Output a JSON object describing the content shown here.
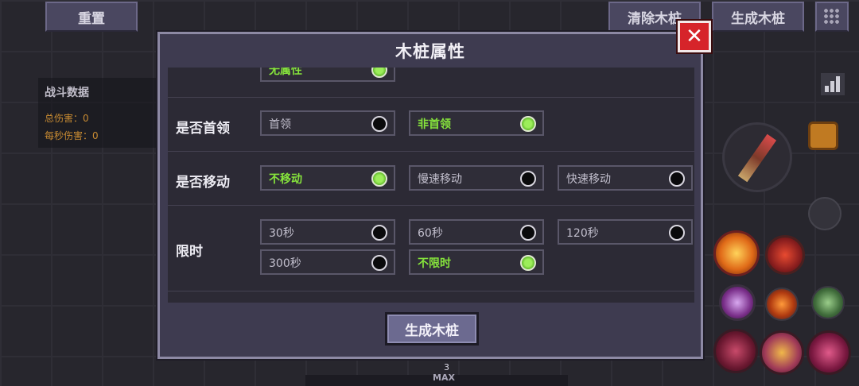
{
  "top_bar": {
    "reset_label": "重置",
    "clear_label": "清除木桩",
    "generate_label": "生成木桩"
  },
  "stats": {
    "title": "战斗数据",
    "total_damage": "总伤害：0",
    "dps": "每秒伤害：0"
  },
  "hud": {
    "level": "3",
    "max_label": "MAX"
  },
  "modal": {
    "title": "木桩属性",
    "partial_option": "无属性",
    "rows": [
      {
        "label": "是否首领",
        "options": [
          {
            "text": "首领",
            "selected": false
          },
          {
            "text": "非首领",
            "selected": true
          }
        ]
      },
      {
        "label": "是否移动",
        "options": [
          {
            "text": "不移动",
            "selected": true
          },
          {
            "text": "慢速移动",
            "selected": false
          },
          {
            "text": "快速移动",
            "selected": false
          }
        ]
      },
      {
        "label": "限时",
        "options": [
          {
            "text": "30秒",
            "selected": false
          },
          {
            "text": "60秒",
            "selected": false
          },
          {
            "text": "120秒",
            "selected": false
          },
          {
            "text": "300秒",
            "selected": false
          },
          {
            "text": "不限时",
            "selected": true
          }
        ]
      }
    ],
    "generate_label": "生成木桩",
    "close_glyph": "✕"
  },
  "colors": {
    "selected_text": "#86e43c",
    "close_red": "#d6242a",
    "panel_bg": "#3e3b50",
    "damage_orange": "#c88b32"
  }
}
